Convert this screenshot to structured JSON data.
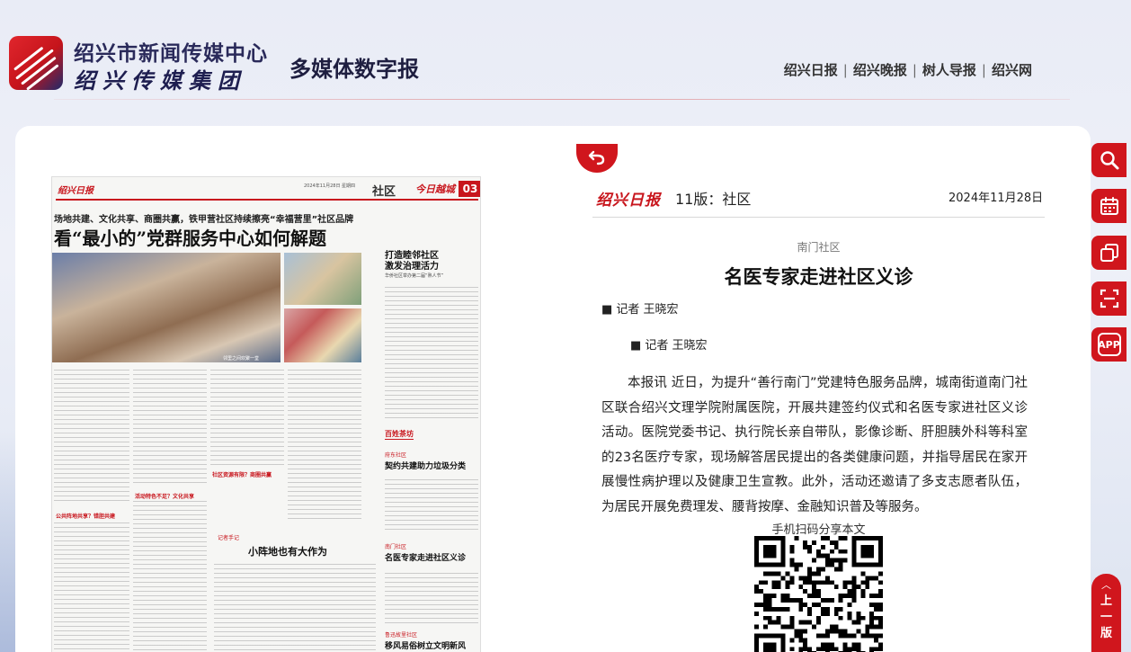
{
  "header": {
    "brand_line1": "绍兴市新闻传媒中心",
    "brand_line2": "绍兴传媒集团",
    "brand_sub": "多媒体数字报",
    "nav": [
      "绍兴日报",
      "绍兴晚报",
      "树人导报",
      "绍兴网"
    ],
    "nav_separator": "|"
  },
  "newspaper_page": {
    "logo": "绍兴日报",
    "date_line": "2024年11月28日  星期四",
    "section": "社区",
    "tag": "今日越城",
    "page_num": "03",
    "kicker": "场地共建、文化共享、商圈共赢，铁甲营社区持续擦亮“幸福营里”社区品牌",
    "headline": "看“最小的”党群服务中心如何解题",
    "photo_caption": "邻里之间欢聚一堂",
    "side_title": "打造睦邻社区\n激发治理活力",
    "side_sub": "华侨社区举办第二届“熟人节”",
    "badge_baixing": "百姓茶坊",
    "story2_label": "府东社区",
    "story2_title": "契约共建助力垃圾分类",
    "story3_label": "南门社区",
    "story3_title": "名医专家走进社区义诊",
    "story4_label": "鲁迅故里社区",
    "story4_title": "移风易俗树立文明新风",
    "mid_title": "小阵地也有大作为",
    "mid_label": "记者手记",
    "sub_h1": "公共阵地共享？错胆共建",
    "sub_h2": "活动特色不足？文化共享",
    "sub_h3": "社区资源有限？商圈共赢"
  },
  "article": {
    "logo": "绍兴日报",
    "edition": "11版：社区",
    "date": "2024年11月28日",
    "column": "南门社区",
    "title": "名医专家走进社区义诊",
    "author1": "■ 记者 王晓宏",
    "author2": "■ 记者 王晓宏",
    "body": "本报讯 近日，为提升“善行南门”党建特色服务品牌，城南街道南门社区联合绍兴文理学院附属医院，开展共建签约仪式和名医专家进社区义诊活动。医院党委书记、执行院长亲自带队，影像诊断、肝胆胰外科等科室的23名医疗专家，现场解答居民提出的各类健康问题，并指导居民在家开展慢性病护理以及健康卫生宣教。此外，活动还邀请了多支志愿者队伍，为居民开展免费理发、腰背按摩、金融知识普及等服务。",
    "qr_label": "手机扫码分享本文"
  },
  "tools": {
    "app_label": "APP",
    "prev_label": "上一版",
    "icons": [
      "search-icon",
      "calendar-icon",
      "copy-icon",
      "scan-icon",
      "app-icon"
    ]
  },
  "colors": {
    "accent": "#d0161d",
    "brand_dark": "#1e1e50"
  }
}
